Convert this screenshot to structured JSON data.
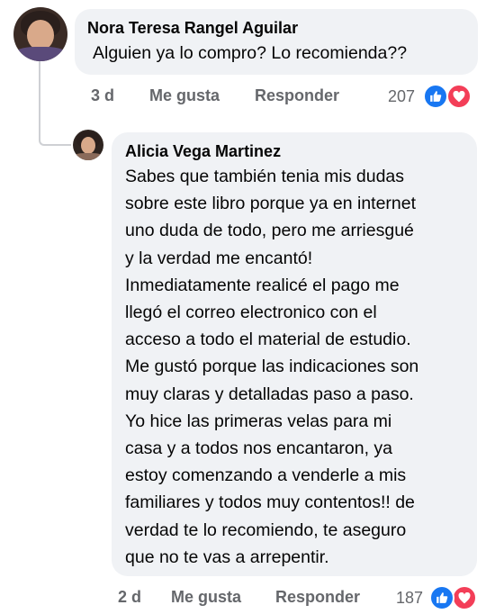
{
  "comment": {
    "author": "Nora Teresa Rangel Aguilar",
    "text": "Alguien ya lo compro? Lo recomienda??",
    "time": "3 d",
    "like_label": "Me gusta",
    "reply_label": "Responder",
    "reactions_count": "207"
  },
  "reply": {
    "author": "Alicia Vega Martinez",
    "text": "Sabes que también tenia mis dudas\nsobre este libro porque ya en internet\nuno duda de todo, pero me arriesgué\ny la verdad me encantó!\nInmediatamente realicé el pago me\nllegó el correo electronico con el\nacceso a todo el material de estudio.\nMe gustó porque las indicaciones son\nmuy claras y detalladas paso a paso.\nYo hice las primeras velas para mi\ncasa y a todos nos encantaron, ya\nestoy comenzando a venderle a mis\nfamiliares y todos muy contentos!! de\nverdad te lo recomiendo, te aseguro\nque no te vas a arrepentir.",
    "time": "2 d",
    "like_label": "Me gusta",
    "reply_label": "Responder",
    "reactions_count": "187"
  },
  "icons": {
    "like": "thumbs-up-icon",
    "love": "heart-icon"
  },
  "colors": {
    "like": "#1877f2",
    "love": "#f33e58",
    "bubble": "#f0f2f5",
    "meta": "#65676b"
  }
}
